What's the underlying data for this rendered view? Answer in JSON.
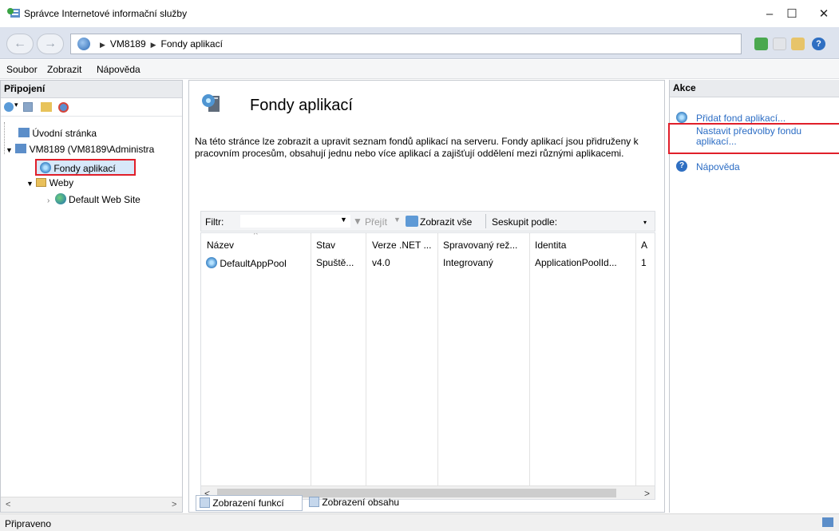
{
  "window": {
    "title": "Správce Internetové informační služby",
    "minimize": "–",
    "maximize": "☐",
    "close": "✕"
  },
  "address": {
    "crumbs": [
      "VM8189",
      "Fondy aplikací"
    ]
  },
  "menu": [
    "Soubor",
    "Zobrazit",
    "Nápověda"
  ],
  "connections": {
    "title": "Připojení",
    "tree": {
      "start": "Úvodní stránka",
      "server": "VM8189 (VM8189\\Administra",
      "app_pools": "Fondy aplikací",
      "sites": "Weby",
      "default_site": "Default Web Site"
    }
  },
  "main": {
    "title": "Fondy aplikací",
    "description": "Na této stránce lze zobrazit a upravit seznam fondů aplikací na serveru. Fondy aplikací jsou přidruženy k pracovním procesům, obsahují jednu nebo více aplikací a zajišťují oddělení mezi různými aplikacemi.",
    "filter": {
      "label": "Filtr:",
      "go": "Přejít",
      "show_all": "Zobrazit vše",
      "group_by": "Seskupit podle:"
    },
    "columns": [
      "Název",
      "Stav",
      "Verze .NET ...",
      "Spravovaný rež...",
      "Identita",
      "A"
    ],
    "rows": [
      {
        "name": "DefaultAppPool",
        "status": "Spuště...",
        "net": "v4.0",
        "mode": "Integrovaný",
        "identity": "ApplicationPoolId...",
        "apps": "1"
      }
    ],
    "view_tabs": [
      "Zobrazení funkcí",
      "Zobrazení obsahu"
    ]
  },
  "actions": {
    "title": "Akce",
    "items": [
      "Přidat fond aplikací...",
      "Nastavit předvolby fondu aplikací...",
      "Nápověda"
    ]
  },
  "status": {
    "text": "Připraveno"
  },
  "colors": {
    "highlight": "#e01f2a",
    "link": "#2b6cc4"
  }
}
